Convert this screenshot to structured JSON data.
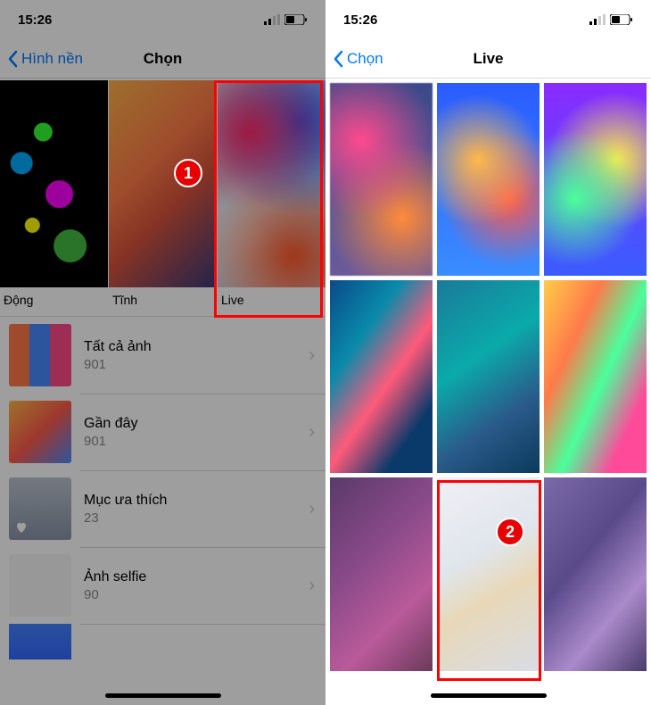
{
  "status": {
    "time": "15:26"
  },
  "left": {
    "back": "Hình nền",
    "title": "Chọn",
    "categories": [
      {
        "label": "Động"
      },
      {
        "label": "Tĩnh"
      },
      {
        "label": "Live"
      }
    ],
    "albums": [
      {
        "name": "Tất cả ảnh",
        "count": "901"
      },
      {
        "name": "Gần đây",
        "count": "901"
      },
      {
        "name": "Mục ưa thích",
        "count": "23"
      },
      {
        "name": "Ảnh selfie",
        "count": "90"
      }
    ],
    "badge": "1"
  },
  "right": {
    "back": "Chọn",
    "title": "Live",
    "badge": "2"
  }
}
